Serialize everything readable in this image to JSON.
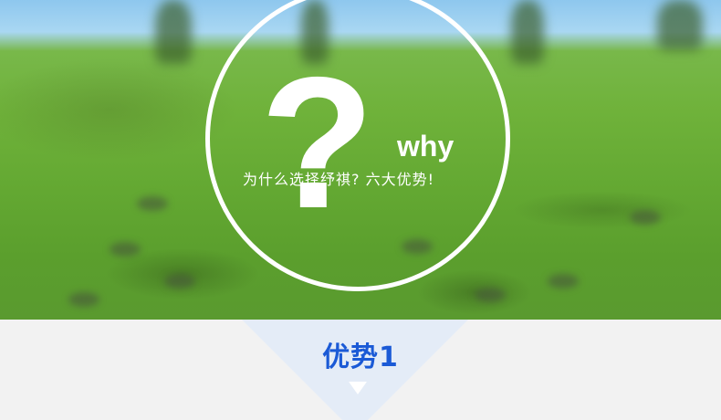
{
  "hero": {
    "question_glyph": "?",
    "why_text": "why",
    "subtitle": "为什么选择纾祺? 六大优势!"
  },
  "section": {
    "title": "优势1"
  },
  "colors": {
    "title_blue": "#1b5ad6",
    "triangle_bg": "#e4ecf7",
    "page_bg": "#f2f2f2",
    "ring": "#ffffff"
  }
}
